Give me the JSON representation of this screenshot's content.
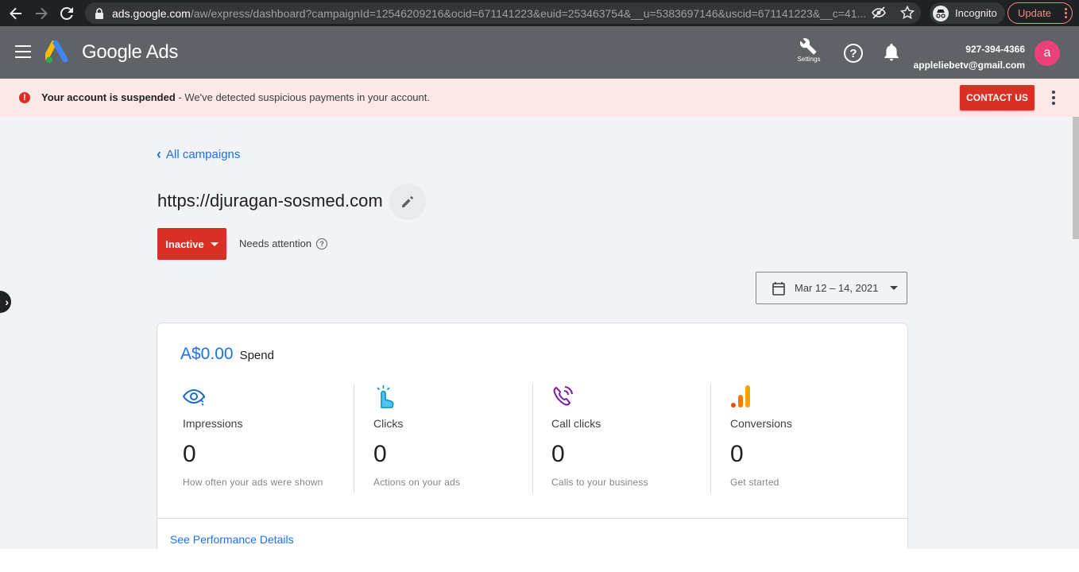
{
  "browser": {
    "url_host": "ads.google.com",
    "url_path": "/aw/express/dashboard?campaignId=12546209216&ocid=671141223&euid=253463754&__u=5383697146&uscid=671141223&__c=41...",
    "incognito_label": "Incognito",
    "update_label": "Update"
  },
  "header": {
    "brand": "Google Ads",
    "settings_label": "Settings",
    "phone": "927-394-4366",
    "email": "appleliebetv@gmail.com",
    "avatar_letter": "a"
  },
  "banner": {
    "title": "Your account is suspended",
    "message": " - We've detected suspicious payments in your account.",
    "contact_label": "CONTACT US"
  },
  "campaign": {
    "back_label": "All campaigns",
    "site": "https://djuragan-sosmed.com",
    "status": "Inactive",
    "attention": "Needs attention",
    "date_range": "Mar 12 – 14, 2021"
  },
  "summary": {
    "spend_amount": "A$0.00",
    "spend_label": "Spend",
    "metrics": [
      {
        "name": "Impressions",
        "value": "0",
        "sub": "How often your ads were shown",
        "icon": "eye-icon"
      },
      {
        "name": "Clicks",
        "value": "0",
        "sub": "Actions on your ads",
        "icon": "touch-click-icon"
      },
      {
        "name": "Call clicks",
        "value": "0",
        "sub": "Calls to your business",
        "icon": "phone-call-icon"
      },
      {
        "name": "Conversions",
        "value": "0",
        "sub": "Get started",
        "icon": "conversion-bars-icon"
      }
    ],
    "details_link": "See Performance Details"
  },
  "colors": {
    "header_bg": "#5f6368",
    "banner_bg": "#fce8e6",
    "danger": "#d93025",
    "link": "#1a73e8",
    "avatar": "#ec407a"
  }
}
